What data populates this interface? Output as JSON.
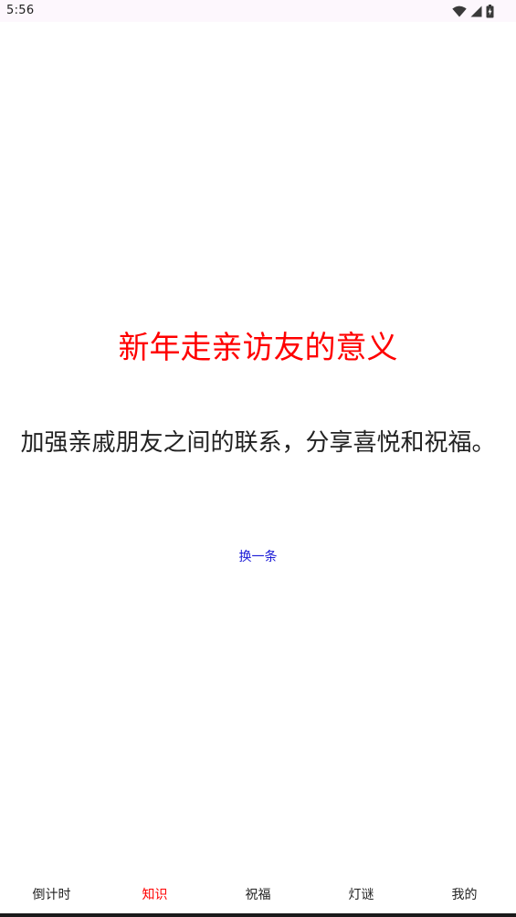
{
  "status_bar": {
    "time": "5:56",
    "icons": [
      "wifi-icon",
      "signal-icon",
      "battery-icon"
    ]
  },
  "knowledge": {
    "title": "新年走亲访友的意义",
    "body": "加强亲戚朋友之间的联系，分享喜悦和祝福。",
    "refresh_label": "换一条"
  },
  "colors": {
    "title": "#ff0000",
    "link": "#1a1ad6",
    "active_tab": "#ff0000"
  },
  "bottom_nav": {
    "active_index": 1,
    "items": [
      {
        "label": "倒计时"
      },
      {
        "label": "知识"
      },
      {
        "label": "祝福"
      },
      {
        "label": "灯谜"
      },
      {
        "label": "我的"
      }
    ]
  }
}
